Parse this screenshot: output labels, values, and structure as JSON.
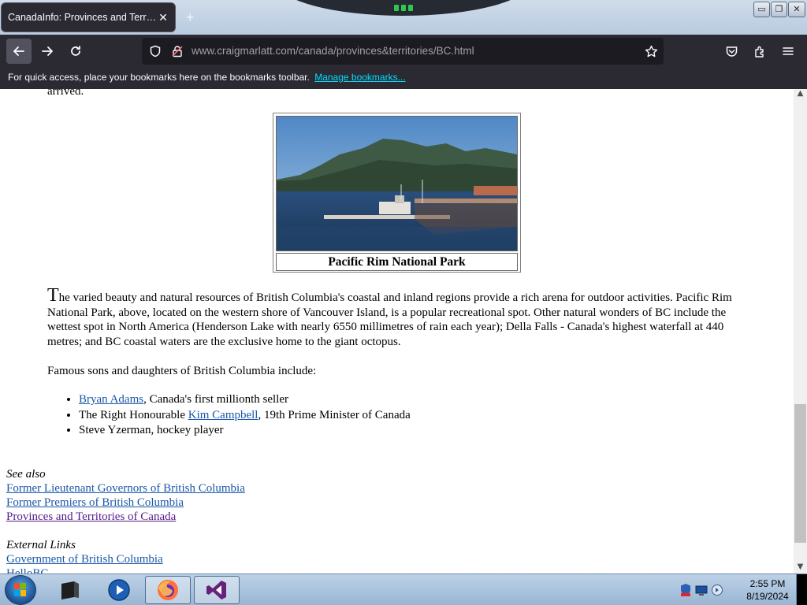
{
  "browser": {
    "tab_title": "CanadaInfo: Provinces and Territories",
    "tab_close": "✕",
    "new_tab": "+",
    "url_domain": "www.craigmarlatt.com",
    "url_path": "/canada/provinces&territories/BC.html",
    "bookmarks_message": "For quick access, place your bookmarks here on the bookmarks toolbar.",
    "bookmarks_link": "Manage bookmarks...",
    "accent": "#00ddff"
  },
  "window_controls": {
    "minimize": "▭",
    "restore": "❐",
    "close": "✕"
  },
  "page": {
    "top_fragment": "arrived.",
    "figure_caption": "Pacific Rim National Park",
    "dropcap": "T",
    "paragraph": "he varied beauty and natural resources of British Columbia's coastal and inland regions provide a rich arena for outdoor activities. Pacific Rim National Park, above, located on the western shore of Vancouver Island, is a popular recreational spot. Other natural wonders of BC include the wettest spot in North America (Henderson Lake with nearly 6550 millimetres of rain each year); Della Falls - Canada's highest waterfall at 440 metres; and BC coastal waters are the exclusive home to the giant octopus.",
    "famous_intro": "Famous sons and daughters of British Columbia include:",
    "famous": [
      {
        "link": "Bryan Adams",
        "rest": ", Canada's first millionth seller"
      },
      {
        "prefix": "The Right Honourable ",
        "link": "Kim Campbell",
        "rest": ", 19th Prime Minister of Canada"
      },
      {
        "text": "Steve Yzerman, hockey player"
      }
    ],
    "see_also_heading": "See also",
    "see_also_links": [
      "Former Lieutenant Governors of British Columbia",
      "Former Premiers of British Columbia",
      "Provinces and Territories of Canada"
    ],
    "external_heading": "External Links",
    "external_links": [
      "Government of British Columbia",
      "HelloBC"
    ],
    "link_color": "#1a57a8",
    "visited_color": "#551a8b"
  },
  "taskbar": {
    "time": "2:55 PM",
    "date": "8/19/2024"
  }
}
